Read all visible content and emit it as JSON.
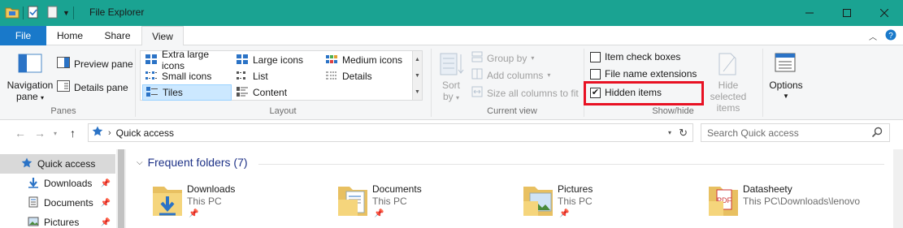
{
  "window": {
    "title": "File Explorer"
  },
  "ribbon_tabs": [
    {
      "label": "File"
    },
    {
      "label": "Home"
    },
    {
      "label": "Share"
    },
    {
      "label": "View"
    }
  ],
  "ribbon": {
    "panes": {
      "navigation_pane_line1": "Navigation",
      "navigation_pane_line2": "pane",
      "preview_pane": "Preview pane",
      "details_pane": "Details pane",
      "group_label": "Panes"
    },
    "layout": {
      "items": [
        {
          "label": "Extra large icons"
        },
        {
          "label": "Large icons"
        },
        {
          "label": "Medium icons"
        },
        {
          "label": "Small icons"
        },
        {
          "label": "List"
        },
        {
          "label": "Details"
        },
        {
          "label": "Tiles"
        },
        {
          "label": "Content"
        }
      ],
      "selected": "Tiles",
      "group_label": "Layout"
    },
    "current_view": {
      "sort_by_line1": "Sort",
      "sort_by_line2": "by",
      "group_by": "Group by",
      "add_columns": "Add columns",
      "size_all_columns": "Size all columns to fit",
      "group_label": "Current view"
    },
    "show_hide": {
      "item_check_boxes": "Item check boxes",
      "item_check_boxes_checked": false,
      "file_name_extensions": "File name extensions",
      "file_name_extensions_checked": false,
      "hidden_items": "Hidden items",
      "hidden_items_checked": true,
      "hide_selected_line1": "Hide selected",
      "hide_selected_line2": "items",
      "group_label": "Show/hide"
    },
    "options": {
      "label": "Options"
    }
  },
  "address_bar": {
    "path": "Quick access",
    "search_placeholder": "Search Quick access"
  },
  "nav_pane": {
    "items": [
      {
        "label": "Quick access"
      },
      {
        "label": "Downloads"
      },
      {
        "label": "Documents"
      },
      {
        "label": "Pictures"
      }
    ]
  },
  "content": {
    "section_title": "Frequent folders (7)",
    "folders": [
      {
        "name": "Downloads",
        "location": "This PC"
      },
      {
        "name": "Documents",
        "location": "This PC"
      },
      {
        "name": "Pictures",
        "location": "This PC"
      },
      {
        "name": "Datasheety",
        "location": "This PC\\Downloads\\lenovo"
      }
    ]
  },
  "colors": {
    "titlebar": "#1aa392",
    "file_tab": "#1979ca",
    "highlight": "#e81123",
    "section_title": "#1e3287"
  }
}
